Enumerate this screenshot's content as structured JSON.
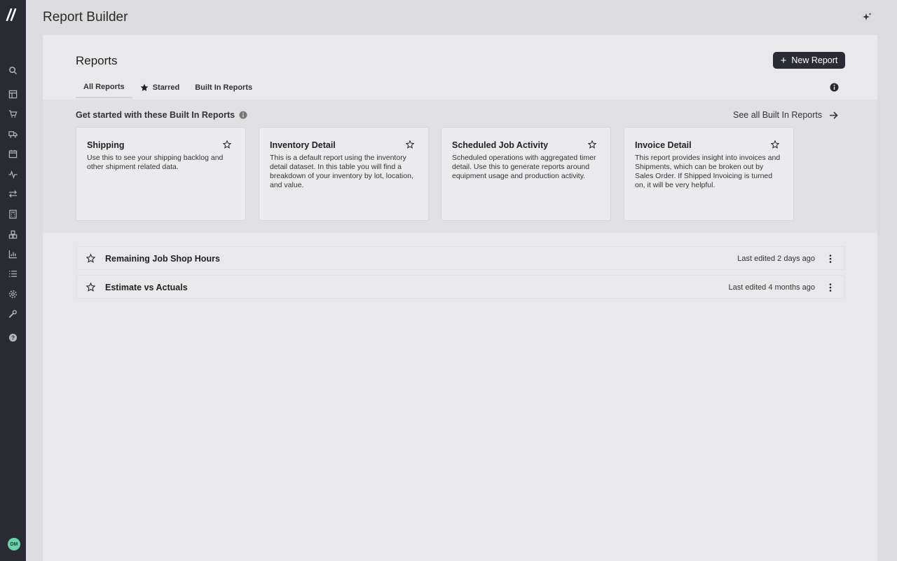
{
  "app": {
    "title": "Report Builder",
    "user_initials": "DM"
  },
  "sidebar": {
    "items": [
      {
        "name": "search-icon"
      },
      {
        "name": "dashboard-icon"
      },
      {
        "name": "cart-icon"
      },
      {
        "name": "truck-icon"
      },
      {
        "name": "calendar-icon"
      },
      {
        "name": "activity-icon"
      },
      {
        "name": "transfer-icon"
      },
      {
        "name": "calculator-icon"
      },
      {
        "name": "boxes-icon"
      },
      {
        "name": "bar-chart-icon"
      },
      {
        "name": "list-icon"
      },
      {
        "name": "gear-icon"
      },
      {
        "name": "wrench-icon"
      },
      {
        "name": "help-icon"
      }
    ]
  },
  "reports": {
    "title": "Reports",
    "new_report_label": "New Report",
    "tabs": [
      {
        "label": "All Reports"
      },
      {
        "label": "Starred"
      },
      {
        "label": "Built In Reports"
      }
    ]
  },
  "builtin": {
    "heading": "Get started with these Built In Reports",
    "see_all_label": "See all Built In Reports",
    "cards": [
      {
        "title": "Shipping",
        "description": "Use this to see your shipping backlog and other shipment related data."
      },
      {
        "title": "Inventory Detail",
        "description": "This is a default report using the inventory detail dataset. In this table you will find a breakdown of your inventory by lot, location, and value."
      },
      {
        "title": "Scheduled Job Activity",
        "description": "Scheduled operations with aggregated timer detail. Use this to generate reports around equipment usage and production activity."
      },
      {
        "title": "Invoice Detail",
        "description": "This report provides insight into invoices and Shipments, which can be broken out by Sales Order. If Shipped Invoicing is turned on, it will be very helpful."
      }
    ]
  },
  "saved_reports": [
    {
      "title": "Remaining Job Shop Hours",
      "edited": "Last edited 2 days ago"
    },
    {
      "title": "Estimate vs Actuals",
      "edited": "Last edited 4 months ago"
    }
  ],
  "colors": {
    "sidebar": "#2a2a33",
    "primary_button": "#2b2b33",
    "avatar": "#6ad3a9"
  }
}
